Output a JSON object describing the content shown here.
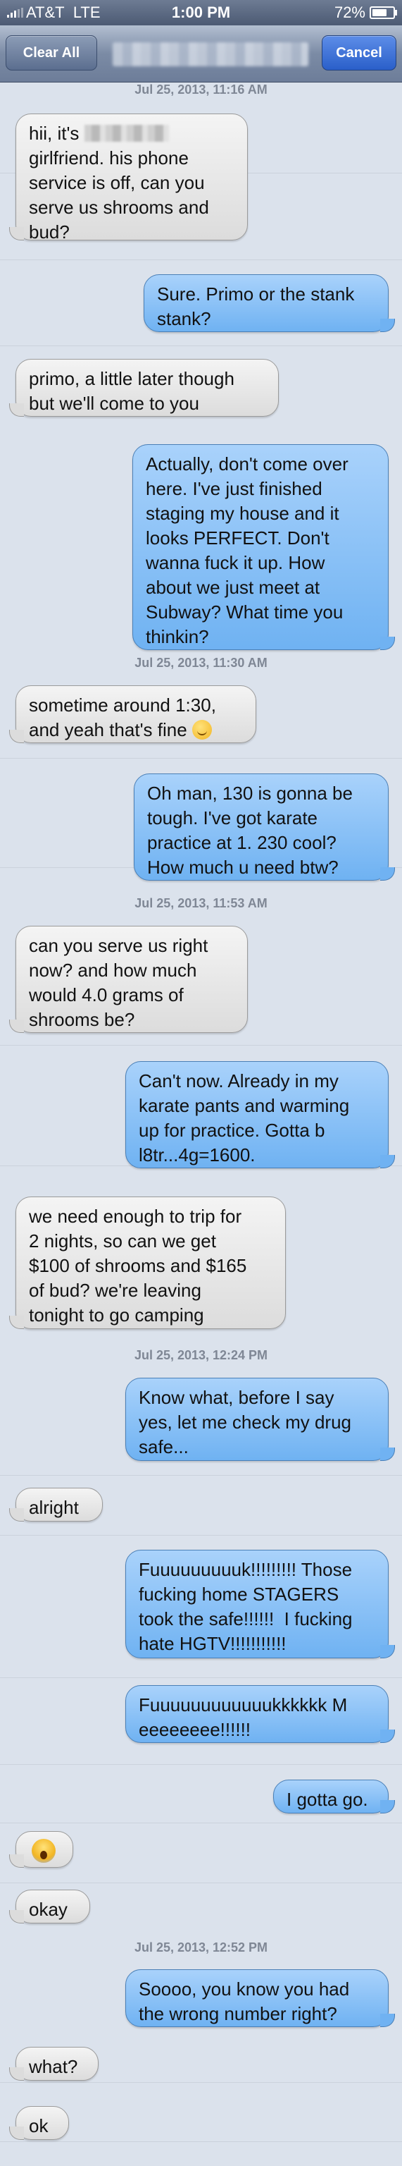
{
  "status": {
    "carrier": "AT&T",
    "network": "LTE",
    "time": "1:00 PM",
    "battery": "72%",
    "battery_level": 0.72
  },
  "nav": {
    "clear_label": "Clear All",
    "cancel_label": "Cancel",
    "contact_name": ""
  },
  "thread": {
    "timestamps": [
      "Jul 25, 2013, 11:16 AM",
      "Jul 25, 2013, 11:30 AM",
      "Jul 25, 2013, 11:53 AM",
      "Jul 25, 2013, 12:24 PM",
      "Jul 25, 2013, 12:52 PM"
    ],
    "messages": [
      {
        "dir": "in",
        "text_a": "hii, it's ",
        "text_b": "\ngirlfriend. his phone\nservice is off, can you\nserve us shrooms and\nbud?"
      },
      {
        "dir": "out",
        "text": "Sure. Primo or the stank\nstank?"
      },
      {
        "dir": "in",
        "text": "primo, a little later though\nbut we'll come to you"
      },
      {
        "dir": "out",
        "text": "Actually, don't come over\nhere. I've just finished\nstaging my house and it\nlooks PERFECT. Don't\nwanna fuck it up. How\nabout we just meet at\nSubway? What time you\nthinkin?"
      },
      {
        "dir": "in",
        "text": "sometime around 1:30,\nand yeah that's fine ",
        "emoji": "smiling-face-icon"
      },
      {
        "dir": "out",
        "text": "Oh man, 130 is gonna be\ntough. I've got karate\npractice at 1. 230 cool?\nHow much u need btw?"
      },
      {
        "dir": "in",
        "text": "can you serve us right\nnow? and how much\nwould 4.0 grams of\nshrooms be?"
      },
      {
        "dir": "out",
        "text": "Can't now. Already in my\nkarate pants and warming\nup for practice. Gotta b\nl8tr...4g=1600."
      },
      {
        "dir": "in",
        "text": "we need enough to trip for\n2 nights, so can we get\n$100 of shrooms and $165\nof bud? we're leaving\ntonight to go camping"
      },
      {
        "dir": "out",
        "text": "Know what, before I say\nyes, let me check my drug\nsafe..."
      },
      {
        "dir": "in",
        "text": "alright"
      },
      {
        "dir": "out",
        "text": "Fuuuuuuuuuk!!!!!!!!! Those\nfucking home STAGERS\ntook the safe!!!!!!  I fucking\nhate HGTV!!!!!!!!!!!"
      },
      {
        "dir": "out",
        "text": "Fuuuuuuuuuuuukkkkkk M\neeeeeeee!!!!!!"
      },
      {
        "dir": "out",
        "text": "I gotta go."
      },
      {
        "dir": "in",
        "emoji": "face-screaming-icon"
      },
      {
        "dir": "in",
        "text": "okay"
      },
      {
        "dir": "out",
        "text": "Soooo, you know you had\nthe wrong number right?"
      },
      {
        "dir": "in",
        "text": "what?"
      },
      {
        "dir": "in",
        "text": "ok"
      }
    ]
  }
}
